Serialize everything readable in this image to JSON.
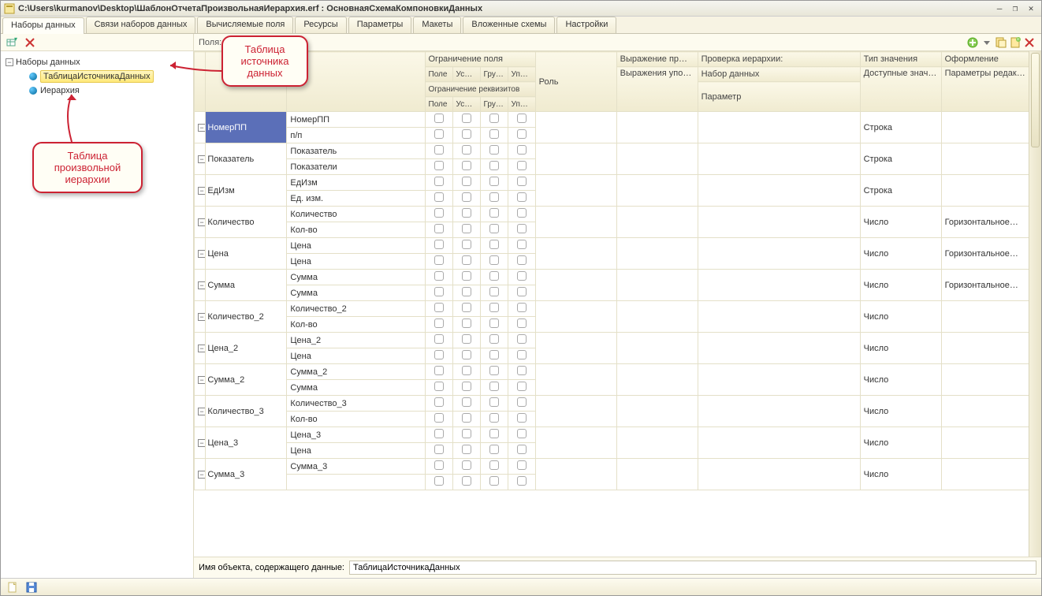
{
  "window": {
    "title": "C:\\Users\\kurmanov\\Desktop\\ШаблонОтчетаПроизвольнаяИерархия.erf : ОсновнаяСхемаКомпоновкиДанных"
  },
  "tabs": [
    "Наборы данных",
    "Связи наборов данных",
    "Вычисляемые поля",
    "Ресурсы",
    "Параметры",
    "Макеты",
    "Вложенные схемы",
    "Настройки"
  ],
  "active_tab": 0,
  "fields_label": "Поля:",
  "sidebar": {
    "root": "Наборы данных",
    "items": [
      {
        "label": "ТаблицаИсточникаДанных",
        "selected": true
      },
      {
        "label": "Иерархия",
        "selected": false
      }
    ]
  },
  "callouts": {
    "c1": "Таблица\nисточника\nданных",
    "c2": "Таблица\nпроизвольной\nиерархии"
  },
  "grid": {
    "headers": {
      "col_field_constraint": "Ограничение поля",
      "col_role": "Роль",
      "col_order_expr": "Выражение пр…",
      "col_hier_check": "Проверка иерархии:",
      "col_value_type": "Тип значения",
      "col_design": "Оформление",
      "sub_pole": "Поле",
      "sub_us": "Ус…",
      "sub_gru": "Гру…",
      "sub_upo": "Упо…",
      "req_constraint": "Ограничение реквизитов",
      "order_exprs": "Выражения упорядочивания",
      "dataset": "Набор данных",
      "param": "Параметр",
      "avail_values": "Доступные значения",
      "edit_params": "Параметры редактирования"
    },
    "rows": [
      {
        "field": "НомерПП",
        "path": "НомерПП",
        "alt": "п/п",
        "type": "Строка",
        "design": ""
      },
      {
        "field": "Показатель",
        "path": "Показатель",
        "alt": "Показатели",
        "type": "Строка",
        "design": ""
      },
      {
        "field": "ЕдИзм",
        "path": "ЕдИзм",
        "alt": "Ед. изм.",
        "type": "Строка",
        "design": ""
      },
      {
        "field": "Количество",
        "path": "Количество",
        "alt": "Кол-во",
        "type": "Число",
        "design": "Горизонтальное…"
      },
      {
        "field": "Цена",
        "path": "Цена",
        "alt": "Цена",
        "type": "Число",
        "design": "Горизонтальное…"
      },
      {
        "field": "Сумма",
        "path": "Сумма",
        "alt": "Сумма",
        "type": "Число",
        "design": "Горизонтальное…"
      },
      {
        "field": "Количество_2",
        "path": "Количество_2",
        "alt": "Кол-во",
        "type": "Число",
        "design": ""
      },
      {
        "field": "Цена_2",
        "path": "Цена_2",
        "alt": "Цена",
        "type": "Число",
        "design": ""
      },
      {
        "field": "Сумма_2",
        "path": "Сумма_2",
        "alt": "Сумма",
        "type": "Число",
        "design": ""
      },
      {
        "field": "Количество_3",
        "path": "Количество_3",
        "alt": "Кол-во",
        "type": "Число",
        "design": ""
      },
      {
        "field": "Цена_3",
        "path": "Цена_3",
        "alt": "Цена",
        "type": "Число",
        "design": ""
      },
      {
        "field": "Сумма_3",
        "path": "Сумма_3",
        "alt": "",
        "type": "Число",
        "design": ""
      }
    ]
  },
  "bottom": {
    "label": "Имя объекта, содержащего данные:",
    "value": "ТаблицаИсточникаДанных"
  }
}
